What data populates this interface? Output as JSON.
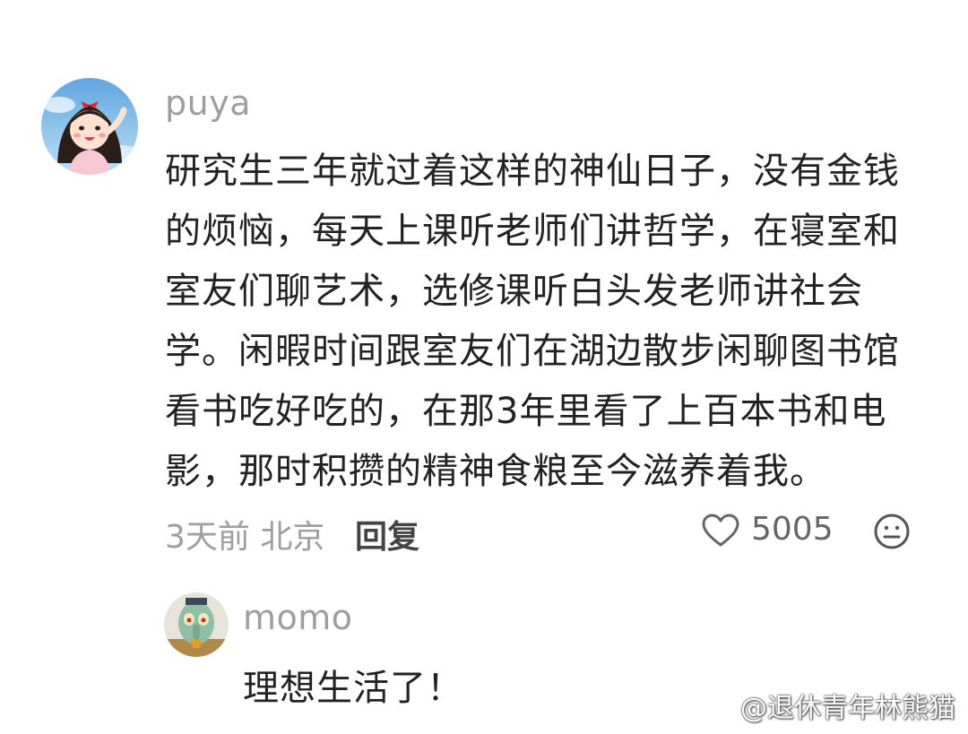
{
  "comment": {
    "username": "puya",
    "text": "研究生三年就过着这样的神仙日子，没有金钱\n的烦恼，每天上课听老师们讲哲学，在寝室和\n室友们聊艺术，选修课听白头发老师讲社会\n学。闲暇时间跟室友们在湖边散步闲聊图书馆\n看书吃好吃的，在那3年里看了上百本书和电\n影，那时积攒的精神食粮至今滋养着我。",
    "time_location": "3天前 北京",
    "reply_label": "回复",
    "like_count": "5005"
  },
  "reply": {
    "username": "momo",
    "text": "理想生活了！"
  },
  "watermark": {
    "text": "@退休青年林熊猫"
  },
  "icons": {
    "like": "heart-outline-icon",
    "emoji": "emoji-face-icon",
    "watermark_logo": "weibo-logo-icon"
  }
}
